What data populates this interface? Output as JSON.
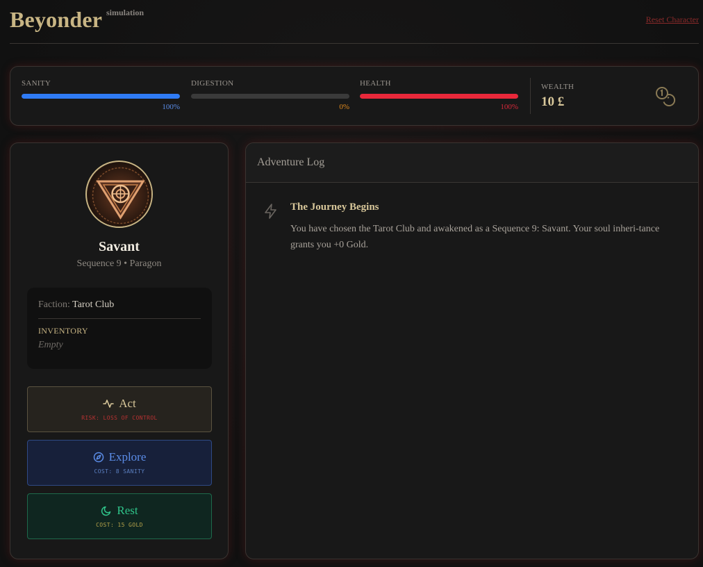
{
  "header": {
    "title": "Beyonder",
    "subtitle": "simulation",
    "reset_label": "Reset Character"
  },
  "stats": {
    "sanity": {
      "label": "SANITY",
      "percent_text": "100%",
      "value": 100,
      "color": "#2f7bf5"
    },
    "digestion": {
      "label": "DIGESTION",
      "percent_text": "0%",
      "value": 0,
      "color": "#e08a1e"
    },
    "health": {
      "label": "HEALTH",
      "percent_text": "100%",
      "value": 100,
      "color": "#e8283a"
    },
    "wealth": {
      "label": "WEALTH",
      "value": "10 £",
      "icon": "coins-icon"
    }
  },
  "character": {
    "emblem_icon": "tarot-emblem-icon",
    "name": "Savant",
    "sequence": "Sequence 9 • Paragon",
    "faction_label": "Faction:",
    "faction_value": "Tarot Club",
    "inventory_label": "INVENTORY",
    "inventory_empty": "Empty"
  },
  "actions": {
    "act": {
      "label": "Act",
      "sub": "RISK: LOSS OF CONTROL",
      "icon": "activity-icon"
    },
    "explore": {
      "label": "Explore",
      "sub": "COST: 8 SANITY",
      "icon": "compass-icon"
    },
    "rest": {
      "label": "Rest",
      "sub": "COST: 15 GOLD",
      "icon": "moon-icon"
    }
  },
  "log": {
    "title": "Adventure Log",
    "entries": [
      {
        "icon": "lightning-icon",
        "title": "The Journey Begins",
        "text": "You have chosen the Tarot Club and awakened as a Sequence 9: Savant. Your soul inheri-tance grants you +0 Gold."
      }
    ]
  },
  "colors": {
    "accent_gold": "#c8b584",
    "danger": "#8a2a2a",
    "panel_bg": "#181818"
  }
}
